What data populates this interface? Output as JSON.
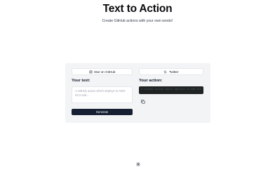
{
  "header": {
    "title": "Text to Action",
    "subtitle": "Create GitHub actions with your own words!"
  },
  "buttons": {
    "github": {
      "label": "Star on GitHub",
      "icon": "github-icon"
    },
    "twitter": {
      "label": "Twitter",
      "icon": "swap-arrows-icon"
    },
    "generate": {
      "label": "Generate"
    }
  },
  "input": {
    "label": "Your text:",
    "placeholder": "A GitHub action which deploys to AWS EC2 and...",
    "value": ""
  },
  "output": {
    "label": "Your action:",
    "value": "A GitHub action which deploys to AWS EC2 and..."
  },
  "icons": {
    "copy": "copy-icon",
    "footer": "settings-icon"
  },
  "colors": {
    "panel_bg": "#f3f4f6",
    "primary_button": "#172033",
    "output_bg": "#1f2322"
  }
}
